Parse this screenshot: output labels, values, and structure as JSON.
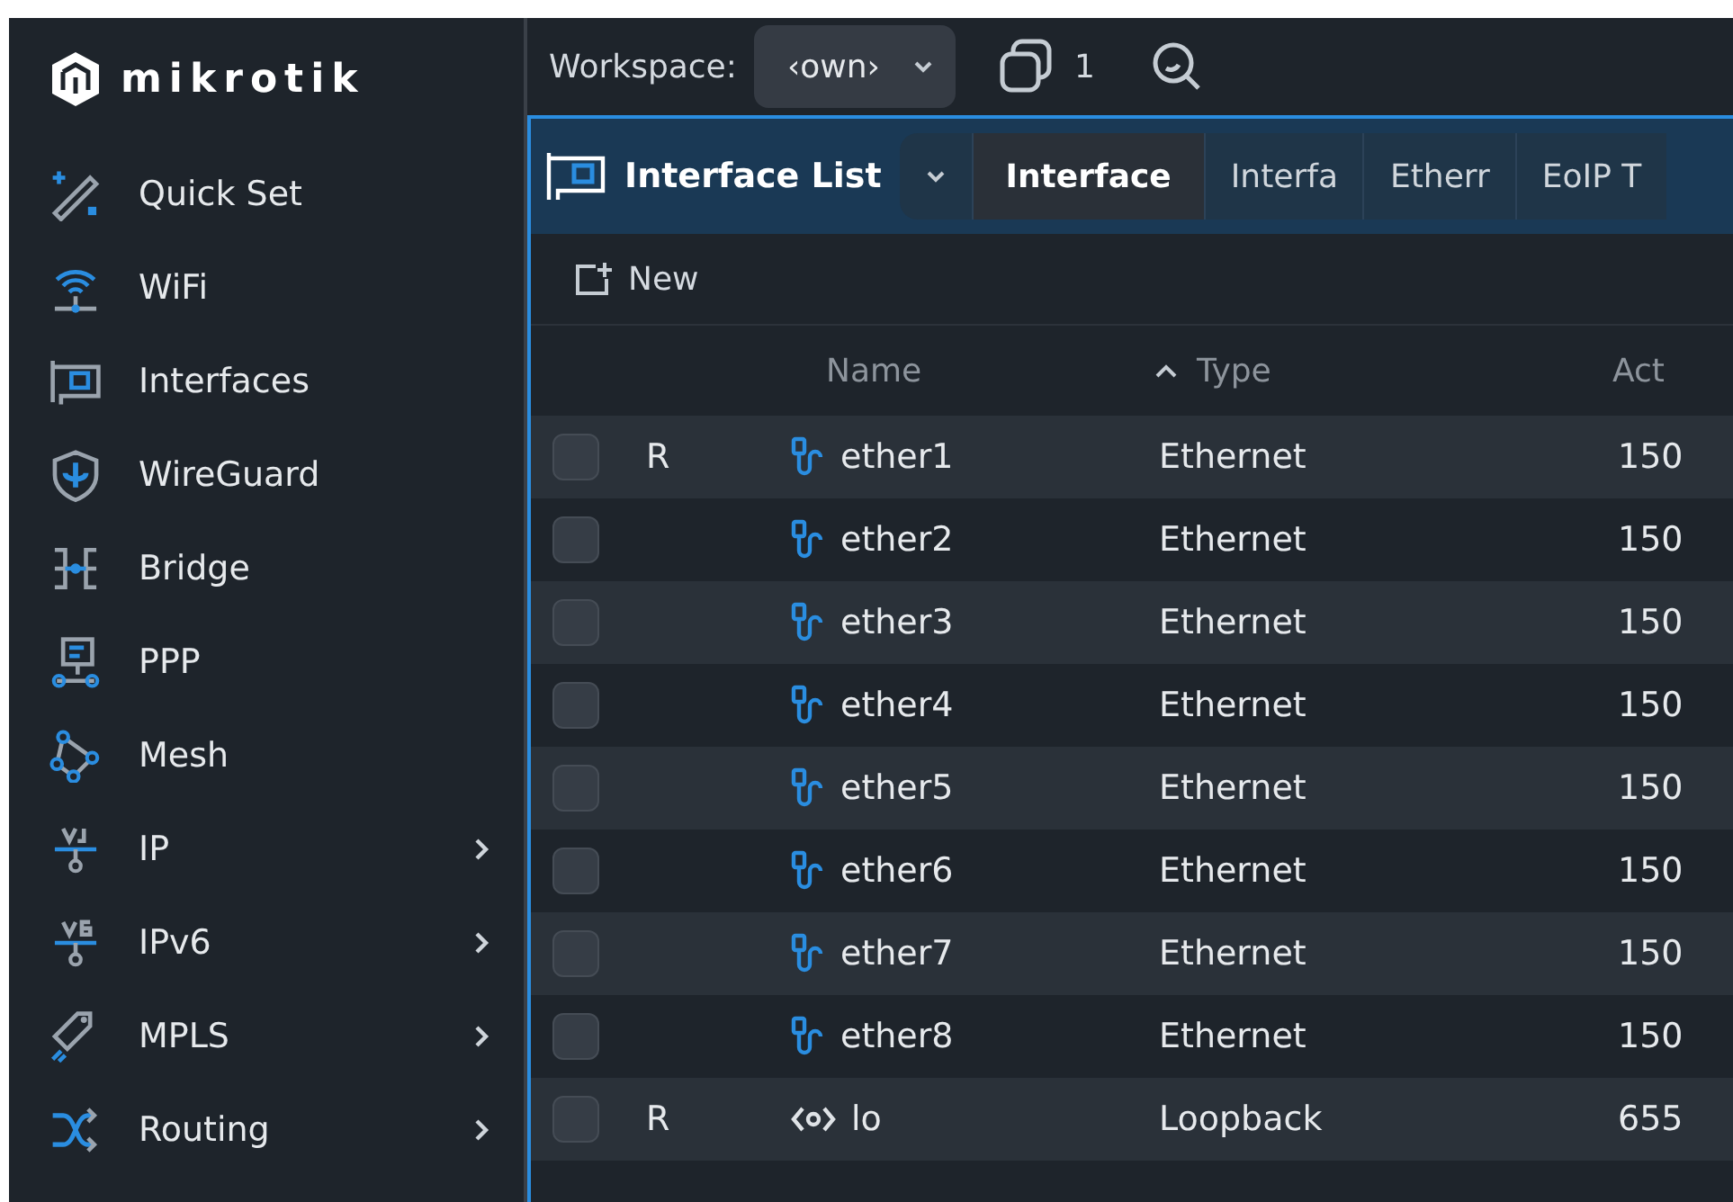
{
  "sidebar": {
    "logo": "mikrotik",
    "items": [
      {
        "label": "Quick Set",
        "has_submenu": false
      },
      {
        "label": "WiFi",
        "has_submenu": false
      },
      {
        "label": "Interfaces",
        "has_submenu": false
      },
      {
        "label": "WireGuard",
        "has_submenu": false
      },
      {
        "label": "Bridge",
        "has_submenu": false
      },
      {
        "label": "PPP",
        "has_submenu": false
      },
      {
        "label": "Mesh",
        "has_submenu": false
      },
      {
        "label": "IP",
        "has_submenu": true
      },
      {
        "label": "IPv6",
        "has_submenu": true
      },
      {
        "label": "MPLS",
        "has_submenu": true
      },
      {
        "label": "Routing",
        "has_submenu": true
      }
    ]
  },
  "topbar": {
    "workspace_label": "Workspace:",
    "workspace_value": "‹own›",
    "window_count": "1"
  },
  "window": {
    "title": "Interface List",
    "tabs": [
      {
        "label": "Interface",
        "selected": true
      },
      {
        "label": "Interfa",
        "selected": false
      },
      {
        "label": "Etherr",
        "selected": false
      },
      {
        "label": "EoIP T",
        "selected": false
      }
    ],
    "toolbar": {
      "new_label": "New"
    },
    "table": {
      "columns": [
        {
          "label": "Name",
          "sorted": false
        },
        {
          "label": "Type",
          "sorted": true
        },
        {
          "label": "Act",
          "sorted": false
        }
      ],
      "rows": [
        {
          "checked": false,
          "flags": "R",
          "kind": "ethernet",
          "name": "ether1",
          "type": "Ethernet",
          "column_3": "150"
        },
        {
          "checked": false,
          "kind": "ethernet",
          "name": "ether2",
          "type": "Ethernet",
          "column_3": "150"
        },
        {
          "checked": false,
          "kind": "ethernet",
          "name": "ether3",
          "type": "Ethernet",
          "column_3": "150"
        },
        {
          "checked": false,
          "kind": "ethernet",
          "name": "ether4",
          "type": "Ethernet",
          "column_3": "150"
        },
        {
          "checked": false,
          "kind": "ethernet",
          "name": "ether5",
          "type": "Ethernet",
          "column_3": "150"
        },
        {
          "checked": false,
          "kind": "ethernet",
          "name": "ether6",
          "type": "Ethernet",
          "column_3": "150"
        },
        {
          "checked": false,
          "kind": "ethernet",
          "name": "ether7",
          "type": "Ethernet",
          "column_3": "150"
        },
        {
          "checked": false,
          "kind": "ethernet",
          "name": "ether8",
          "type": "Ethernet",
          "column_3": "150"
        },
        {
          "checked": false,
          "flags": "R",
          "kind": "loopback",
          "name": "lo",
          "type": "Loopback",
          "column_3": "655"
        }
      ]
    }
  }
}
